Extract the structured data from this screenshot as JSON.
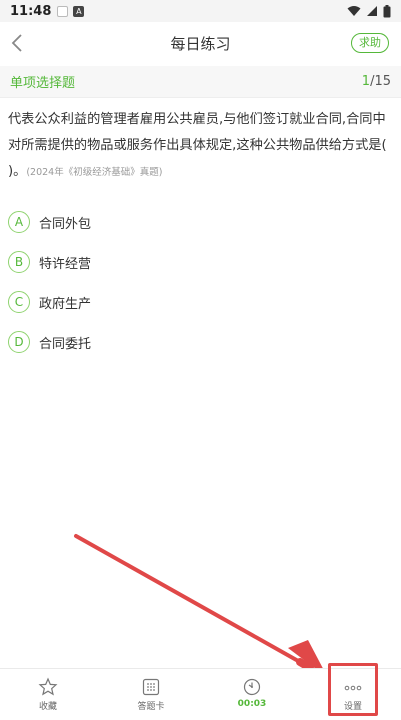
{
  "status_bar": {
    "time": "11:48",
    "notif_icon_1": "square-icon",
    "notif_icon_2": "a-badge-icon",
    "notif_letter": "A"
  },
  "header": {
    "title": "每日练习",
    "help_label": "求助"
  },
  "section": {
    "title": "单项选择题",
    "current": "1",
    "total": "/15"
  },
  "question": {
    "text": "代表公众利益的管理者雇用公共雇员,与他们签订就业合同,合同中对所需提供的物品或服务作出具体规定,这种公共物品供给方式是( )。",
    "source": "(2024年《初级经济基础》真题)"
  },
  "options": [
    {
      "letter": "A",
      "text": "合同外包"
    },
    {
      "letter": "B",
      "text": "特许经营"
    },
    {
      "letter": "C",
      "text": "政府生产"
    },
    {
      "letter": "D",
      "text": "合同委托"
    }
  ],
  "toolbar": {
    "favorite_label": "收藏",
    "answer_card_label": "答题卡",
    "timer_label": "00:03",
    "settings_label": "设置"
  },
  "colors": {
    "accent": "#55b83a",
    "annotation": "#e04848"
  }
}
